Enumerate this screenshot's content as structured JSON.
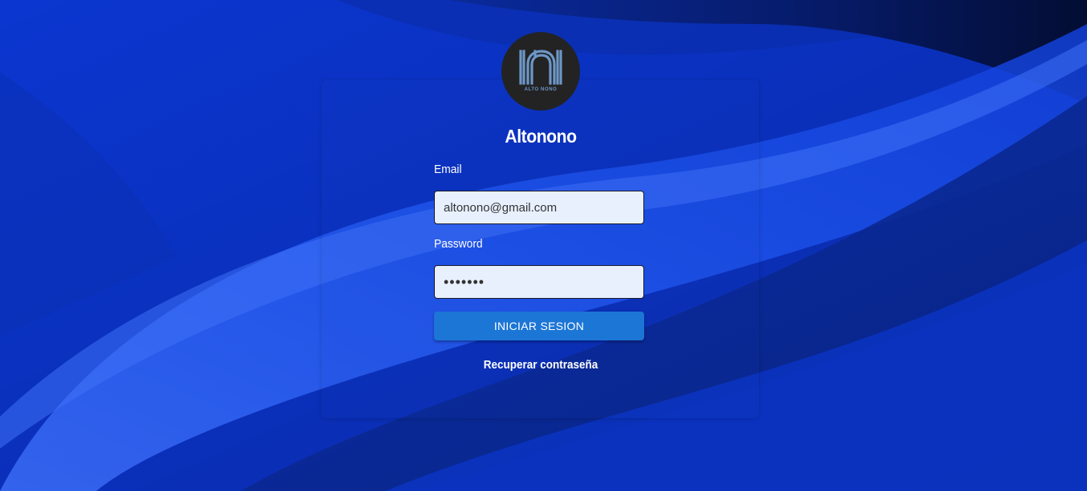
{
  "brand": {
    "name": "Altonono",
    "logo_text": "ALTO NONO",
    "logo_bg": "#232323",
    "logo_color": "#6d97c8"
  },
  "form": {
    "email_label": "Email",
    "email_value": "altonono@gmail.com",
    "password_label": "Password",
    "password_value": "1234567",
    "submit_label": "INICIAR SESION",
    "recover_link": "Recuperar contraseña"
  },
  "colors": {
    "background": "#0a34c9",
    "button": "#1c76d6",
    "input_bg": "#e8f0fe"
  }
}
